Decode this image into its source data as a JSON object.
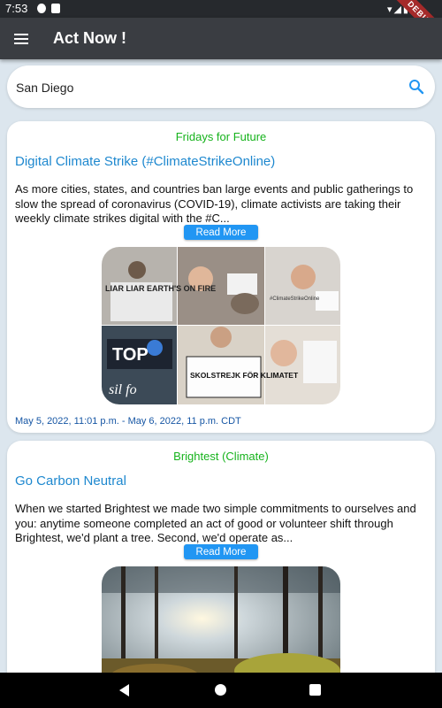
{
  "status": {
    "time": "7:53"
  },
  "debug_banner": "DEBUG",
  "app": {
    "title": "Act Now !"
  },
  "search": {
    "value": "San Diego",
    "icon": "search-icon"
  },
  "colors": {
    "source": "#17b31d",
    "title_link": "#1e88cf",
    "button": "#2196f3",
    "date": "#1656a4",
    "app_bar": "#3a3d42"
  },
  "cards": [
    {
      "source": "Fridays for Future",
      "title": "Digital Climate Strike (#ClimateStrikeOnline)",
      "description": "As more cities, states, and countries ban large events and public gatherings to slow the spread of coronavirus (COVID-19), climate activists are taking their weekly climate strikes digital with the #C...",
      "button": "Read More",
      "image_texts": [
        "LIAR LIAR EARTH'S ON FIRE",
        "SKOLSTREJK FÖR KLIMATET",
        "#ClimateStrikeOnline",
        "TOP",
        "sil fo"
      ],
      "date": "May 5, 2022, 11:01 p.m. - May 6, 2022, 11 p.m. CDT"
    },
    {
      "source": "Brightest (Climate)",
      "title": "Go Carbon Neutral",
      "description": "When we started Brightest we made two simple commitments to ourselves and you: anytime someone completed an act of good or volunteer shift through Brightest, we'd plant a tree. Second, we'd operate as...",
      "button": "Read More"
    }
  ]
}
